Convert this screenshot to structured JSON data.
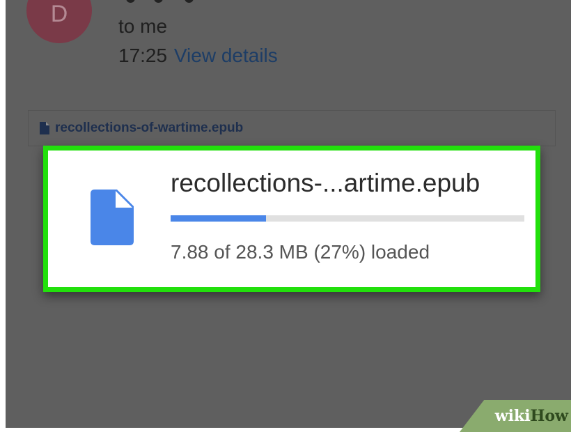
{
  "email": {
    "avatar_letter": "D",
    "recipient": "to me",
    "time": "17:25",
    "view_details": "View details",
    "attachment_name": "recollections-of-wartime.epub"
  },
  "download": {
    "title": "recollections-...artime.epub",
    "progress_fraction": 0.27,
    "status": "7.88 of 28.3 MB (27%) loaded",
    "icon": "document-icon"
  },
  "watermark": {
    "part1": "wiki",
    "part2": "How"
  },
  "colors": {
    "overlay": "#5f5f5f",
    "highlight_border": "#22e00c",
    "progress_fill": "#4a86e8",
    "progress_track": "#e0e0e0",
    "file_icon": "#4a86e8"
  }
}
